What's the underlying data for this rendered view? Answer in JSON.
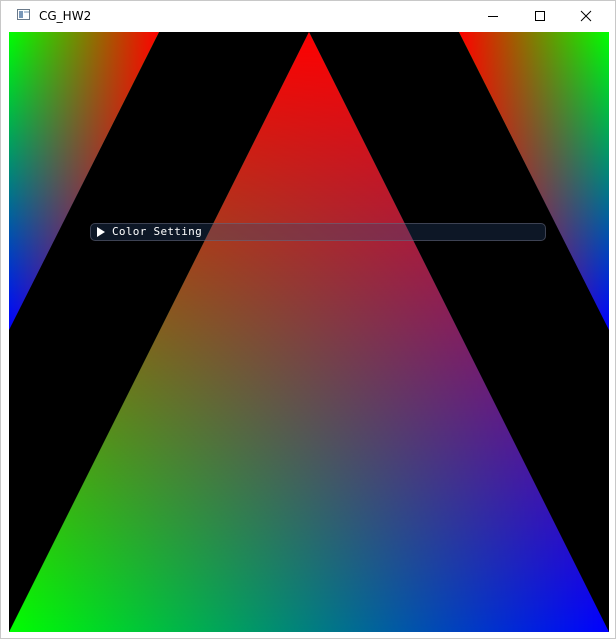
{
  "window": {
    "title": "CG_HW2",
    "icon": "app-window-icon",
    "controls": {
      "minimize_icon": "minimize-icon",
      "maximize_icon": "maximize-icon",
      "close_icon": "close-icon"
    }
  },
  "scene": {
    "background_color": "#000000",
    "vertex_colors": {
      "top": "#ff0000",
      "bottom_left": "#00ff00",
      "bottom_right": "#0000ff"
    }
  },
  "imgui": {
    "header_label": "Color Setting",
    "collapsed": true,
    "arrow_icon": "triangle-right-icon"
  }
}
